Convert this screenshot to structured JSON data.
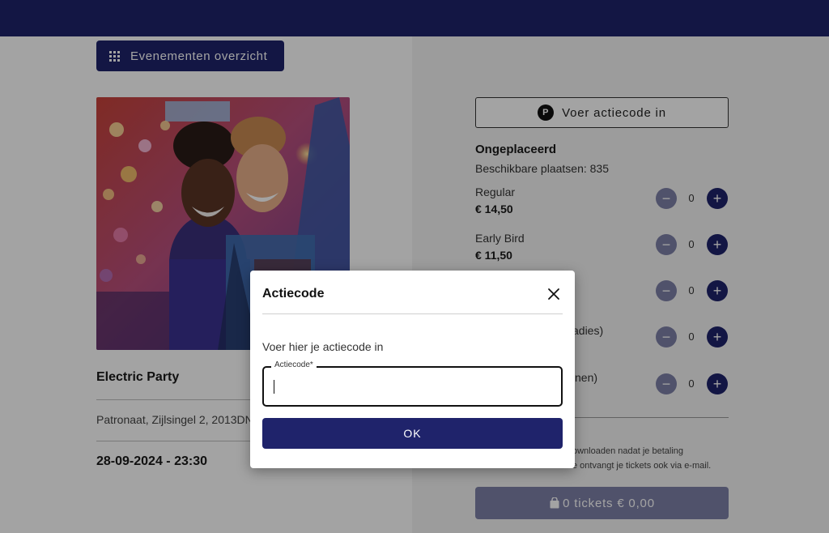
{
  "header": {
    "color": "#1f236b"
  },
  "nav": {
    "overview_label": "Evenementen overzicht"
  },
  "event": {
    "title": "Electric Party",
    "address": "Patronaat, Zijlsingel 2, 2013DN",
    "date": "28-09-2024 - 23:30"
  },
  "promo": {
    "button_label": "Voer actiecode in",
    "badge": "P"
  },
  "tickets": {
    "section_title": "Ongeplaceerd",
    "available": "Beschikbare plaatsen: 835",
    "rows": [
      {
        "name": "Regular",
        "price": "€ 14,50",
        "qty": "0"
      },
      {
        "name": "Early Bird",
        "price": "€ 11,50",
        "qty": "0"
      },
      {
        "name": "",
        "price": "",
        "qty": "0"
      },
      {
        "name": "adies)",
        "price": "",
        "qty": "0"
      },
      {
        "name": "nen)",
        "price": "",
        "qty": "0"
      }
    ],
    "minus": "−",
    "plus": "+"
  },
  "info": {
    "line1": "ownloaden nadat je betaling",
    "line2": "e ontvangt je tickets ook via e-mail."
  },
  "cart": {
    "label": "0 tickets € 0,00"
  },
  "modal": {
    "title": "Actiecode",
    "instruction": "Voer hier je actiecode in",
    "field_label": "Actiecode*",
    "field_value": "",
    "ok_label": "OK"
  },
  "colors": {
    "primary": "#1f236b",
    "disabled": "#7e80a8"
  }
}
